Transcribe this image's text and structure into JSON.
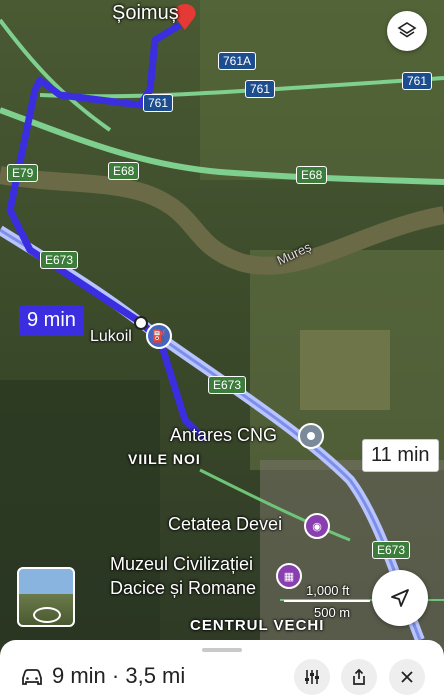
{
  "places": {
    "destination": "Șoimuș",
    "lukoil": "Lukoil",
    "antares": "Antares CNG",
    "viile_noi": "VIILE NOI",
    "cetatea": "Cetatea Devei",
    "muzeul_line1": "Muzeul Civilizației",
    "muzeul_line2": "Dacice și Romane",
    "centrul": "CENTRUL VECHI",
    "river": "Mureș"
  },
  "roads": {
    "r761a": "761A",
    "r761_1": "761",
    "r761_2": "761",
    "r761_3": "761",
    "e79": "E79",
    "e68_1": "E68",
    "e68_2": "E68",
    "e673_1": "E673",
    "e673_2": "E673",
    "e673_3": "E673"
  },
  "routes": {
    "selected_time": "9 min",
    "alternate_time": "11 min"
  },
  "scale": {
    "feet": "1,000 ft",
    "meters": "500 m"
  },
  "summary": {
    "text": "9 min · 3,5 mi"
  },
  "icons": {
    "layers": "layers-icon",
    "navigate": "navigation-arrow-icon",
    "car": "car-icon",
    "options": "sliders-icon",
    "share": "share-icon",
    "close": "close-icon"
  },
  "colors": {
    "route_primary": "#3a2ee0",
    "route_alternate": "#b8c4ff",
    "highway": "#7fcf8f"
  }
}
